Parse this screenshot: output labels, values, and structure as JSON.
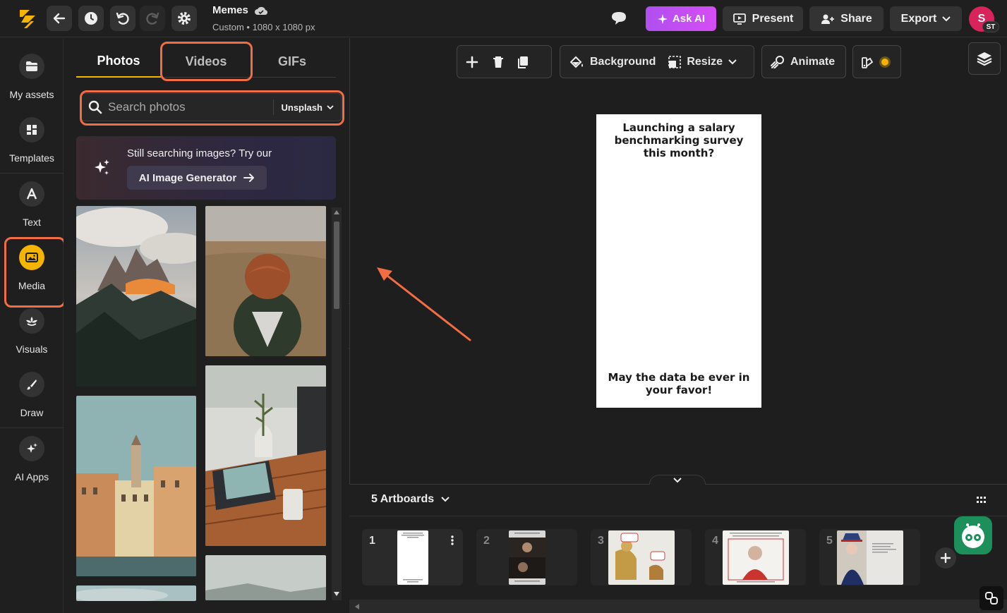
{
  "topbar": {
    "title": "Memes",
    "subtitle": "Custom • 1080 x 1080 px",
    "ask_ai_label": "Ask AI",
    "present_label": "Present",
    "share_label": "Share",
    "export_label": "Export",
    "avatar_initial": "S",
    "avatar_badge": "ST"
  },
  "rail": {
    "items": [
      {
        "label": "My assets",
        "icon": "folder-icon"
      },
      {
        "label": "Templates",
        "icon": "templates-icon"
      },
      {
        "label": "Text",
        "icon": "text-icon"
      },
      {
        "label": "Media",
        "icon": "image-icon"
      },
      {
        "label": "Visuals",
        "icon": "visuals-icon"
      },
      {
        "label": "Draw",
        "icon": "brush-icon"
      },
      {
        "label": "AI Apps",
        "icon": "sparkle-icon"
      }
    ],
    "active": "Media"
  },
  "panel": {
    "tabs": [
      {
        "label": "Photos"
      },
      {
        "label": "Videos"
      },
      {
        "label": "GIFs"
      }
    ],
    "active_tab": "Photos",
    "search": {
      "placeholder": "Search photos",
      "value": "",
      "source": "Unsplash"
    },
    "promo": {
      "text": "Still searching images? Try our",
      "button_label": "AI Image Generator"
    }
  },
  "toolbar": {
    "background_label": "Background",
    "resize_label": "Resize",
    "animate_label": "Animate"
  },
  "artboard": {
    "top_text": "Launching a salary benchmarking survey this month?",
    "bottom_text": "May the data be ever in your favor!"
  },
  "bottom": {
    "artboards_label": "5 Artboards",
    "cards": [
      {
        "num": "1"
      },
      {
        "num": "2"
      },
      {
        "num": "3"
      },
      {
        "num": "4"
      },
      {
        "num": "5"
      }
    ]
  },
  "colors": {
    "accent": "#f4b400",
    "highlight": "#f26d43",
    "ask_ai": "#c04ef2",
    "avatar": "#d8245a"
  }
}
